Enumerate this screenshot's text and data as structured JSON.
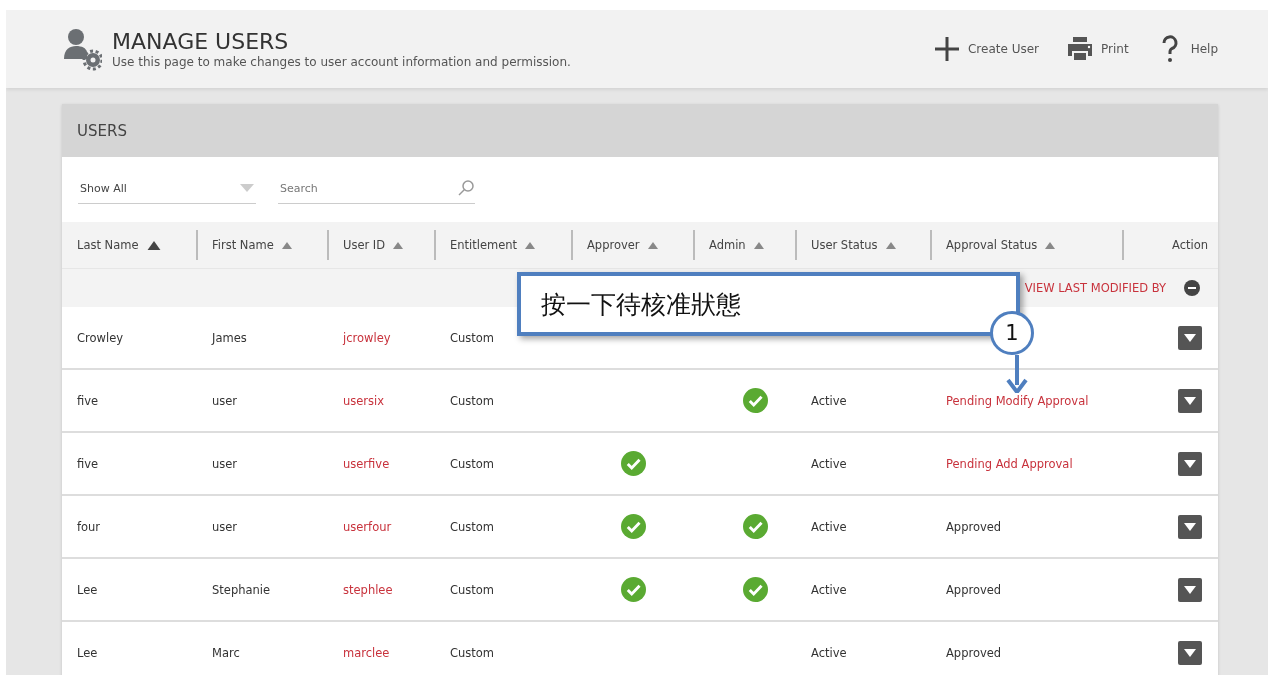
{
  "header": {
    "title": "MANAGE USERS",
    "subtitle": "Use this page to make changes to user account information and permission.",
    "actions": [
      {
        "kind": "create",
        "label": "Create User"
      },
      {
        "kind": "print",
        "label": "Print"
      },
      {
        "kind": "help",
        "label": "Help"
      }
    ]
  },
  "panel": {
    "title": "USERS",
    "filter": {
      "value": "Show All"
    },
    "search": {
      "placeholder": "Search"
    },
    "columns": [
      {
        "label": "Last Name",
        "active": true
      },
      {
        "label": "First Name",
        "active": false
      },
      {
        "label": "User ID",
        "active": false
      },
      {
        "label": "Entitlement",
        "active": false
      },
      {
        "label": "Approver",
        "active": false
      },
      {
        "label": "Admin",
        "active": false
      },
      {
        "label": "User Status",
        "active": false
      },
      {
        "label": "Approval Status",
        "active": false
      },
      {
        "label": "Action"
      }
    ],
    "view_link": "VIEW LAST MODIFIED BY",
    "rows": [
      {
        "last_name": "Crowley",
        "first_name": "James",
        "user_id": "jcrowley",
        "entitlement": "Custom",
        "approver": false,
        "admin": false
      },
      {
        "last_name": "five",
        "first_name": "user",
        "user_id": "usersix",
        "entitlement": "Custom",
        "approver": false,
        "admin": true,
        "user_status": "Active",
        "approval_status": "Pending Modify Approval",
        "pending": true
      },
      {
        "last_name": "five",
        "first_name": "user",
        "user_id": "userfive",
        "entitlement": "Custom",
        "approver": true,
        "admin": false,
        "user_status": "Active",
        "approval_status": "Pending Add Approval",
        "pending": true
      },
      {
        "last_name": "four",
        "first_name": "user",
        "user_id": "userfour",
        "entitlement": "Custom",
        "approver": true,
        "admin": true,
        "user_status": "Active",
        "approval_status": "Approved",
        "pending": false
      },
      {
        "last_name": "Lee",
        "first_name": "Stephanie",
        "user_id": "stephlee",
        "entitlement": "Custom",
        "approver": true,
        "admin": true,
        "user_status": "Active",
        "approval_status": "Approved",
        "pending": false
      },
      {
        "last_name": "Lee",
        "first_name": "Marc",
        "user_id": "marclee",
        "entitlement": "Custom",
        "approver": false,
        "admin": false,
        "user_status": "Active",
        "approval_status": "Approved",
        "pending": false
      }
    ]
  },
  "callout": {
    "text": "按一下待核准狀態",
    "step": "1"
  }
}
